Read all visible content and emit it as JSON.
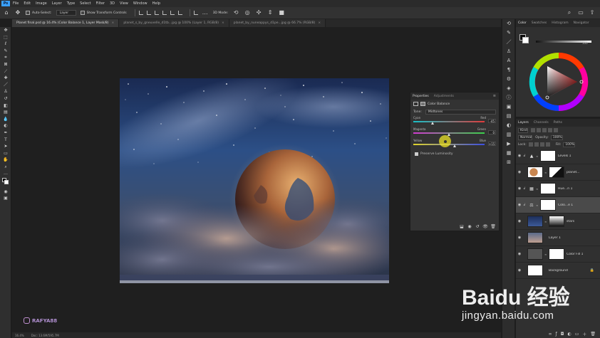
{
  "app": {
    "logo": "Ps",
    "menu": [
      "File",
      "Edit",
      "Image",
      "Layer",
      "Type",
      "Select",
      "Filter",
      "3D",
      "View",
      "Window",
      "Help"
    ]
  },
  "options": {
    "auto_select_label": "Auto-Select:",
    "auto_select_value": "Layer",
    "transform_controls_label": "Show Transform Controls",
    "mode_3d_label": "3D Mode:"
  },
  "tabs": [
    {
      "label": "Planet final.psd @ 16.4% (Color Balance 1, Layer Mask/8)",
      "active": true
    },
    {
      "label": "planet_s_by_gneuvelle_d1tb...jpg @ 100% (Layer 1, RGB/8)",
      "active": false
    },
    {
      "label": "planet_by_nuneappys_d1pe...jpg @ 66.7% (RGB/8)",
      "active": false
    }
  ],
  "toolbar_icons": [
    "move-tool-icon",
    "marquee-tool-icon",
    "lasso-tool-icon",
    "quick-select-tool-icon",
    "crop-tool-icon",
    "frame-tool-icon",
    "eyedropper-tool-icon",
    "healing-brush-icon",
    "brush-tool-icon",
    "clone-stamp-icon",
    "history-brush-icon",
    "eraser-tool-icon",
    "gradient-tool-icon",
    "blur-tool-icon",
    "dodge-tool-icon",
    "pen-tool-icon",
    "type-tool-icon",
    "path-select-icon",
    "shape-tool-icon",
    "hand-tool-icon",
    "zoom-tool-icon",
    "more-tools-icon"
  ],
  "properties": {
    "tabs": [
      "Properties",
      "Adjustments"
    ],
    "title": "Color Balance",
    "tone_label": "Tone:",
    "tone_value": "Midtones",
    "sliders": [
      {
        "left": "Cyan",
        "right": "Red",
        "value": "-45",
        "position": 0.27,
        "gradient": [
          "#18c0c8",
          "#e23b3b"
        ]
      },
      {
        "left": "Magenta",
        "right": "Green",
        "value": "0",
        "position": 0.5,
        "gradient": [
          "#d23ad2",
          "#3ad24a"
        ]
      },
      {
        "left": "Yellow",
        "right": "Blue",
        "value": "+15",
        "position": 0.58,
        "gradient": [
          "#e0d42a",
          "#3b4ee2"
        ]
      }
    ],
    "preserve_label": "Preserve Luminosity"
  },
  "color_panel": {
    "tabs": [
      "Color",
      "Swatches",
      "Histogram",
      "Navigator"
    ],
    "slider_value": "100"
  },
  "layers_panel": {
    "tabs": [
      "Layers",
      "Channels",
      "Paths"
    ],
    "kind_label": "Kind",
    "blend_value": "Normal",
    "opacity_label": "Opacity:",
    "opacity_value": "100%",
    "lock_label": "Lock:",
    "fill_label": "Fill:",
    "fill_value": "100%",
    "layers": [
      {
        "name": "Levels 1",
        "type": "adjustment",
        "icon": "levels-icon",
        "selected": false,
        "clipped": true
      },
      {
        "name": "planet...",
        "type": "image",
        "thumb": "#c98650",
        "selected": false,
        "clipped": false,
        "mask": "dark"
      },
      {
        "name": "Hue...n 1",
        "type": "adjustment",
        "icon": "hue-icon",
        "selected": false,
        "clipped": true
      },
      {
        "name": "Colo...e 1",
        "type": "adjustment",
        "icon": "balance-icon",
        "selected": true,
        "clipped": true
      },
      {
        "name": "stars",
        "type": "image",
        "thumb": "#2b4a8a",
        "selected": false,
        "clipped": false,
        "mask": "gradient"
      },
      {
        "name": "Layer 1",
        "type": "image",
        "thumb": "#7a6a6a",
        "selected": false,
        "clipped": false
      },
      {
        "name": "Color Fill 1",
        "type": "fill",
        "thumb": "#555555",
        "selected": false,
        "clipped": false
      },
      {
        "name": "Background",
        "type": "image",
        "thumb": "#ffffff",
        "selected": false,
        "clipped": false,
        "locked": true
      }
    ]
  },
  "status": {
    "zoom": "16.4%",
    "doc": "Doc: 13.6M/595.7M"
  },
  "watermark": {
    "handle": "RAFYA88",
    "baidu_brand": "Baidu 经验",
    "baidu_url": "jingyan.baidu.com"
  },
  "colors": {
    "accent": "#3aa0ff",
    "cursor": "#ece228"
  }
}
